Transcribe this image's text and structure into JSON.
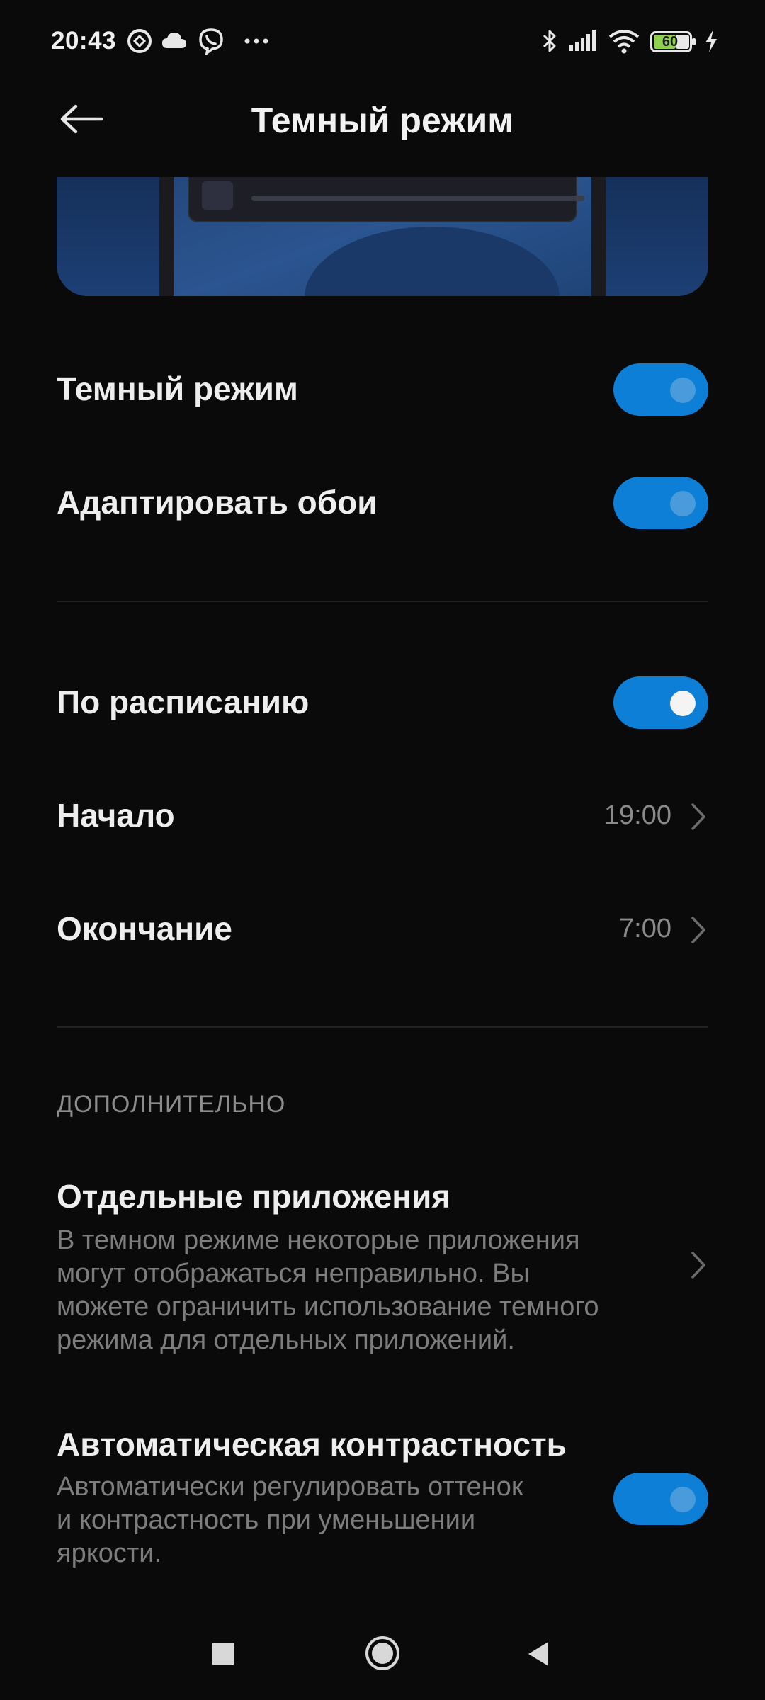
{
  "status_bar": {
    "time": "20:43",
    "battery_level": "60",
    "left_icons": [
      "vpn-icon",
      "cloud-icon",
      "viber-icon",
      "more-notifications-icon"
    ],
    "right_icons": [
      "bluetooth-icon",
      "signal-icon",
      "wifi-icon",
      "battery-icon",
      "charging-icon"
    ]
  },
  "header": {
    "title": "Темный режим",
    "back_icon": "arrow-left-icon"
  },
  "settings": {
    "dark_mode": {
      "label": "Темный режим",
      "enabled": true
    },
    "adapt_wallpaper": {
      "label": "Адаптировать обои",
      "enabled": true
    },
    "scheduled": {
      "label": "По расписанию",
      "enabled": true
    },
    "start": {
      "label": "Начало",
      "value": "19:00"
    },
    "end": {
      "label": "Окончание",
      "value": "7:00"
    }
  },
  "additional": {
    "header": "ДОПОЛНИТЕЛЬНО",
    "separate_apps": {
      "title": "Отдельные приложения",
      "description_lines": [
        "В темном режиме некоторые приложения",
        "могут отображаться неправильно. Вы",
        "можете ограничить использование темного",
        "режима для отдельных приложений."
      ]
    },
    "auto_contrast": {
      "title": "Автоматическая контрастность",
      "description_lines": [
        "Автоматически регулировать оттенок",
        "и контрастность при уменьшении",
        "яркости."
      ],
      "enabled": true
    }
  },
  "colors": {
    "background": "#0a0a0a",
    "accent": "#0d7fd6",
    "primary_text": "#eeeeee",
    "secondary_text": "#8a8a8a"
  },
  "nav_bar": {
    "buttons": [
      "recents-square-icon",
      "home-circle-icon",
      "back-triangle-icon"
    ]
  }
}
